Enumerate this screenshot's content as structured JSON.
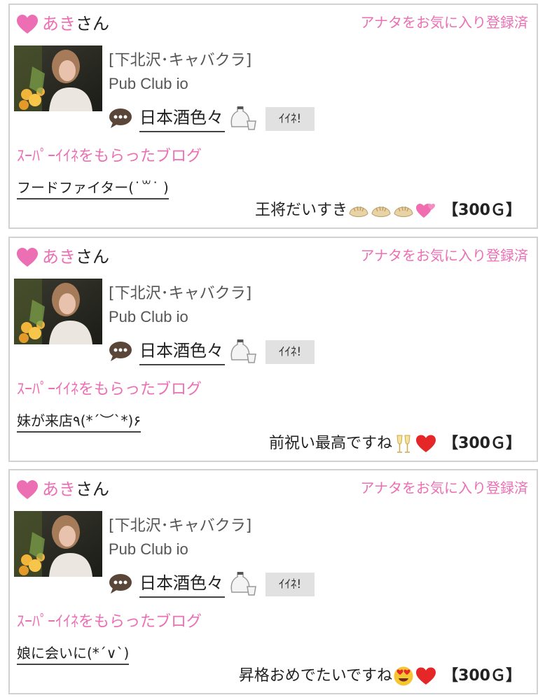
{
  "common": {
    "user_name": "あき",
    "user_suffix": "さん",
    "fav_status": "アナタをお気に入り登録済",
    "shop_area": "[下北沢･キャバクラ]",
    "shop_name": "Pub Club io",
    "blog_title": "日本酒色々",
    "iine_label": "ｲｲﾈ!",
    "super_label": "ｽｰﾊﾟｰｲｲﾈをもらったブログ",
    "colors": {
      "accent_pink": "#ec6fb3",
      "border": "#d2d2d2",
      "button_gray": "#e1e1e1"
    },
    "icons": [
      "heart-icon",
      "chat-bubble-icon",
      "sake-icon"
    ]
  },
  "cards": [
    {
      "source_blog": "フードファイター(˙꒳˙ )",
      "comment_text": "王将だいすき",
      "comment_emojis": [
        "gyoza-icon",
        "gyoza-icon",
        "gyoza-icon",
        "two-hearts-icon"
      ],
      "price": "【300Ｇ】"
    },
    {
      "source_blog": "妹が来店٩(*´︶`*)۶",
      "comment_text": "前祝い最高ですね",
      "comment_emojis": [
        "champagne-glasses-icon",
        "red-heart-icon"
      ],
      "price": "【300Ｇ】"
    },
    {
      "source_blog": "娘に会いに(*´∨`)",
      "comment_text": "昇格おめでたいですね",
      "comment_emojis": [
        "heart-eyes-face-icon",
        "red-heart-icon"
      ],
      "price": "【300Ｇ】"
    }
  ]
}
